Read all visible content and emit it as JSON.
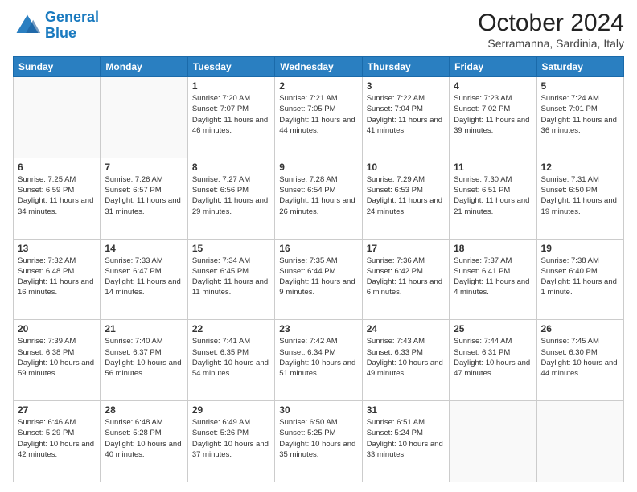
{
  "header": {
    "logo_line1": "General",
    "logo_line2": "Blue",
    "month": "October 2024",
    "location": "Serramanna, Sardinia, Italy"
  },
  "weekdays": [
    "Sunday",
    "Monday",
    "Tuesday",
    "Wednesday",
    "Thursday",
    "Friday",
    "Saturday"
  ],
  "weeks": [
    [
      {
        "day": "",
        "info": ""
      },
      {
        "day": "",
        "info": ""
      },
      {
        "day": "1",
        "info": "Sunrise: 7:20 AM\nSunset: 7:07 PM\nDaylight: 11 hours and 46 minutes."
      },
      {
        "day": "2",
        "info": "Sunrise: 7:21 AM\nSunset: 7:05 PM\nDaylight: 11 hours and 44 minutes."
      },
      {
        "day": "3",
        "info": "Sunrise: 7:22 AM\nSunset: 7:04 PM\nDaylight: 11 hours and 41 minutes."
      },
      {
        "day": "4",
        "info": "Sunrise: 7:23 AM\nSunset: 7:02 PM\nDaylight: 11 hours and 39 minutes."
      },
      {
        "day": "5",
        "info": "Sunrise: 7:24 AM\nSunset: 7:01 PM\nDaylight: 11 hours and 36 minutes."
      }
    ],
    [
      {
        "day": "6",
        "info": "Sunrise: 7:25 AM\nSunset: 6:59 PM\nDaylight: 11 hours and 34 minutes."
      },
      {
        "day": "7",
        "info": "Sunrise: 7:26 AM\nSunset: 6:57 PM\nDaylight: 11 hours and 31 minutes."
      },
      {
        "day": "8",
        "info": "Sunrise: 7:27 AM\nSunset: 6:56 PM\nDaylight: 11 hours and 29 minutes."
      },
      {
        "day": "9",
        "info": "Sunrise: 7:28 AM\nSunset: 6:54 PM\nDaylight: 11 hours and 26 minutes."
      },
      {
        "day": "10",
        "info": "Sunrise: 7:29 AM\nSunset: 6:53 PM\nDaylight: 11 hours and 24 minutes."
      },
      {
        "day": "11",
        "info": "Sunrise: 7:30 AM\nSunset: 6:51 PM\nDaylight: 11 hours and 21 minutes."
      },
      {
        "day": "12",
        "info": "Sunrise: 7:31 AM\nSunset: 6:50 PM\nDaylight: 11 hours and 19 minutes."
      }
    ],
    [
      {
        "day": "13",
        "info": "Sunrise: 7:32 AM\nSunset: 6:48 PM\nDaylight: 11 hours and 16 minutes."
      },
      {
        "day": "14",
        "info": "Sunrise: 7:33 AM\nSunset: 6:47 PM\nDaylight: 11 hours and 14 minutes."
      },
      {
        "day": "15",
        "info": "Sunrise: 7:34 AM\nSunset: 6:45 PM\nDaylight: 11 hours and 11 minutes."
      },
      {
        "day": "16",
        "info": "Sunrise: 7:35 AM\nSunset: 6:44 PM\nDaylight: 11 hours and 9 minutes."
      },
      {
        "day": "17",
        "info": "Sunrise: 7:36 AM\nSunset: 6:42 PM\nDaylight: 11 hours and 6 minutes."
      },
      {
        "day": "18",
        "info": "Sunrise: 7:37 AM\nSunset: 6:41 PM\nDaylight: 11 hours and 4 minutes."
      },
      {
        "day": "19",
        "info": "Sunrise: 7:38 AM\nSunset: 6:40 PM\nDaylight: 11 hours and 1 minute."
      }
    ],
    [
      {
        "day": "20",
        "info": "Sunrise: 7:39 AM\nSunset: 6:38 PM\nDaylight: 10 hours and 59 minutes."
      },
      {
        "day": "21",
        "info": "Sunrise: 7:40 AM\nSunset: 6:37 PM\nDaylight: 10 hours and 56 minutes."
      },
      {
        "day": "22",
        "info": "Sunrise: 7:41 AM\nSunset: 6:35 PM\nDaylight: 10 hours and 54 minutes."
      },
      {
        "day": "23",
        "info": "Sunrise: 7:42 AM\nSunset: 6:34 PM\nDaylight: 10 hours and 51 minutes."
      },
      {
        "day": "24",
        "info": "Sunrise: 7:43 AM\nSunset: 6:33 PM\nDaylight: 10 hours and 49 minutes."
      },
      {
        "day": "25",
        "info": "Sunrise: 7:44 AM\nSunset: 6:31 PM\nDaylight: 10 hours and 47 minutes."
      },
      {
        "day": "26",
        "info": "Sunrise: 7:45 AM\nSunset: 6:30 PM\nDaylight: 10 hours and 44 minutes."
      }
    ],
    [
      {
        "day": "27",
        "info": "Sunrise: 6:46 AM\nSunset: 5:29 PM\nDaylight: 10 hours and 42 minutes."
      },
      {
        "day": "28",
        "info": "Sunrise: 6:48 AM\nSunset: 5:28 PM\nDaylight: 10 hours and 40 minutes."
      },
      {
        "day": "29",
        "info": "Sunrise: 6:49 AM\nSunset: 5:26 PM\nDaylight: 10 hours and 37 minutes."
      },
      {
        "day": "30",
        "info": "Sunrise: 6:50 AM\nSunset: 5:25 PM\nDaylight: 10 hours and 35 minutes."
      },
      {
        "day": "31",
        "info": "Sunrise: 6:51 AM\nSunset: 5:24 PM\nDaylight: 10 hours and 33 minutes."
      },
      {
        "day": "",
        "info": ""
      },
      {
        "day": "",
        "info": ""
      }
    ]
  ]
}
